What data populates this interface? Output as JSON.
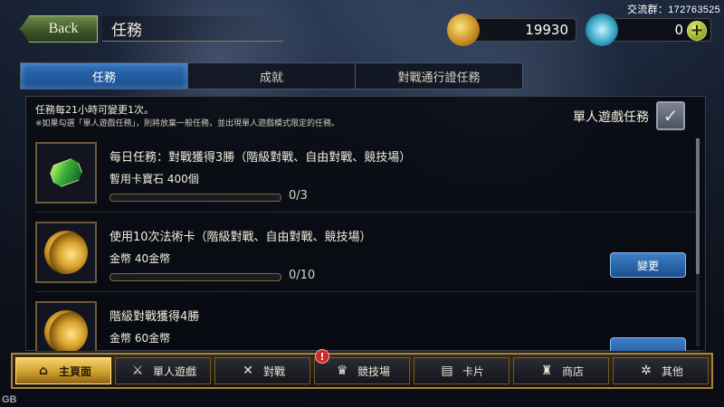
{
  "watermark": "交流群：172763525",
  "header": {
    "back_label": "Back",
    "title": "任務"
  },
  "currency": {
    "gold": {
      "icon": "gold-coin-icon",
      "value": "19930"
    },
    "crystal": {
      "icon": "crystal-icon",
      "value": "0",
      "plus": "+"
    }
  },
  "tabs": [
    {
      "label": "任務",
      "active": true
    },
    {
      "label": "成就",
      "active": false
    },
    {
      "label": "對戰通行證任務",
      "active": false
    }
  ],
  "panel": {
    "info_line1": "任務每21小時可變更1次。",
    "info_line2": "※如果勾選「單人遊戲任務」，則將放棄一般任務，並出現單人遊戲模式限定的任務。",
    "solo_label": "單人遊戲任務",
    "solo_checked": true,
    "change_label": "變更",
    "missions": [
      {
        "title": "每日任務：對戰獲得3勝（階級對戰、自由對戰、競技場）",
        "reward": "暫用卡寶石 400個",
        "progress_text": "0/3",
        "progress": 0,
        "icon": "gem-icon",
        "has_change": false
      },
      {
        "title": "使用10次法術卡（階級對戰、自由對戰、競技場）",
        "reward": "金幣 40金幣",
        "progress_text": "0/10",
        "progress": 0,
        "icon": "coins-icon",
        "has_change": true
      },
      {
        "title": "階級對戰獲得4勝",
        "reward": "金幣 60金幣",
        "icon": "coins-icon",
        "has_change": true
      }
    ]
  },
  "bottom_nav": [
    {
      "label": "主頁面",
      "icon": "home-icon",
      "active": true
    },
    {
      "label": "單人遊戲",
      "icon": "sword-icon",
      "active": false
    },
    {
      "label": "對戰",
      "icon": "crossed-swords-icon",
      "active": false
    },
    {
      "label": "競技場",
      "icon": "arena-icon",
      "active": false,
      "badge": "!"
    },
    {
      "label": "卡片",
      "icon": "cards-icon",
      "active": false
    },
    {
      "label": "商店",
      "icon": "shop-icon",
      "active": false
    },
    {
      "label": "其他",
      "icon": "other-icon",
      "active": false
    }
  ],
  "corner_logo": "GB"
}
